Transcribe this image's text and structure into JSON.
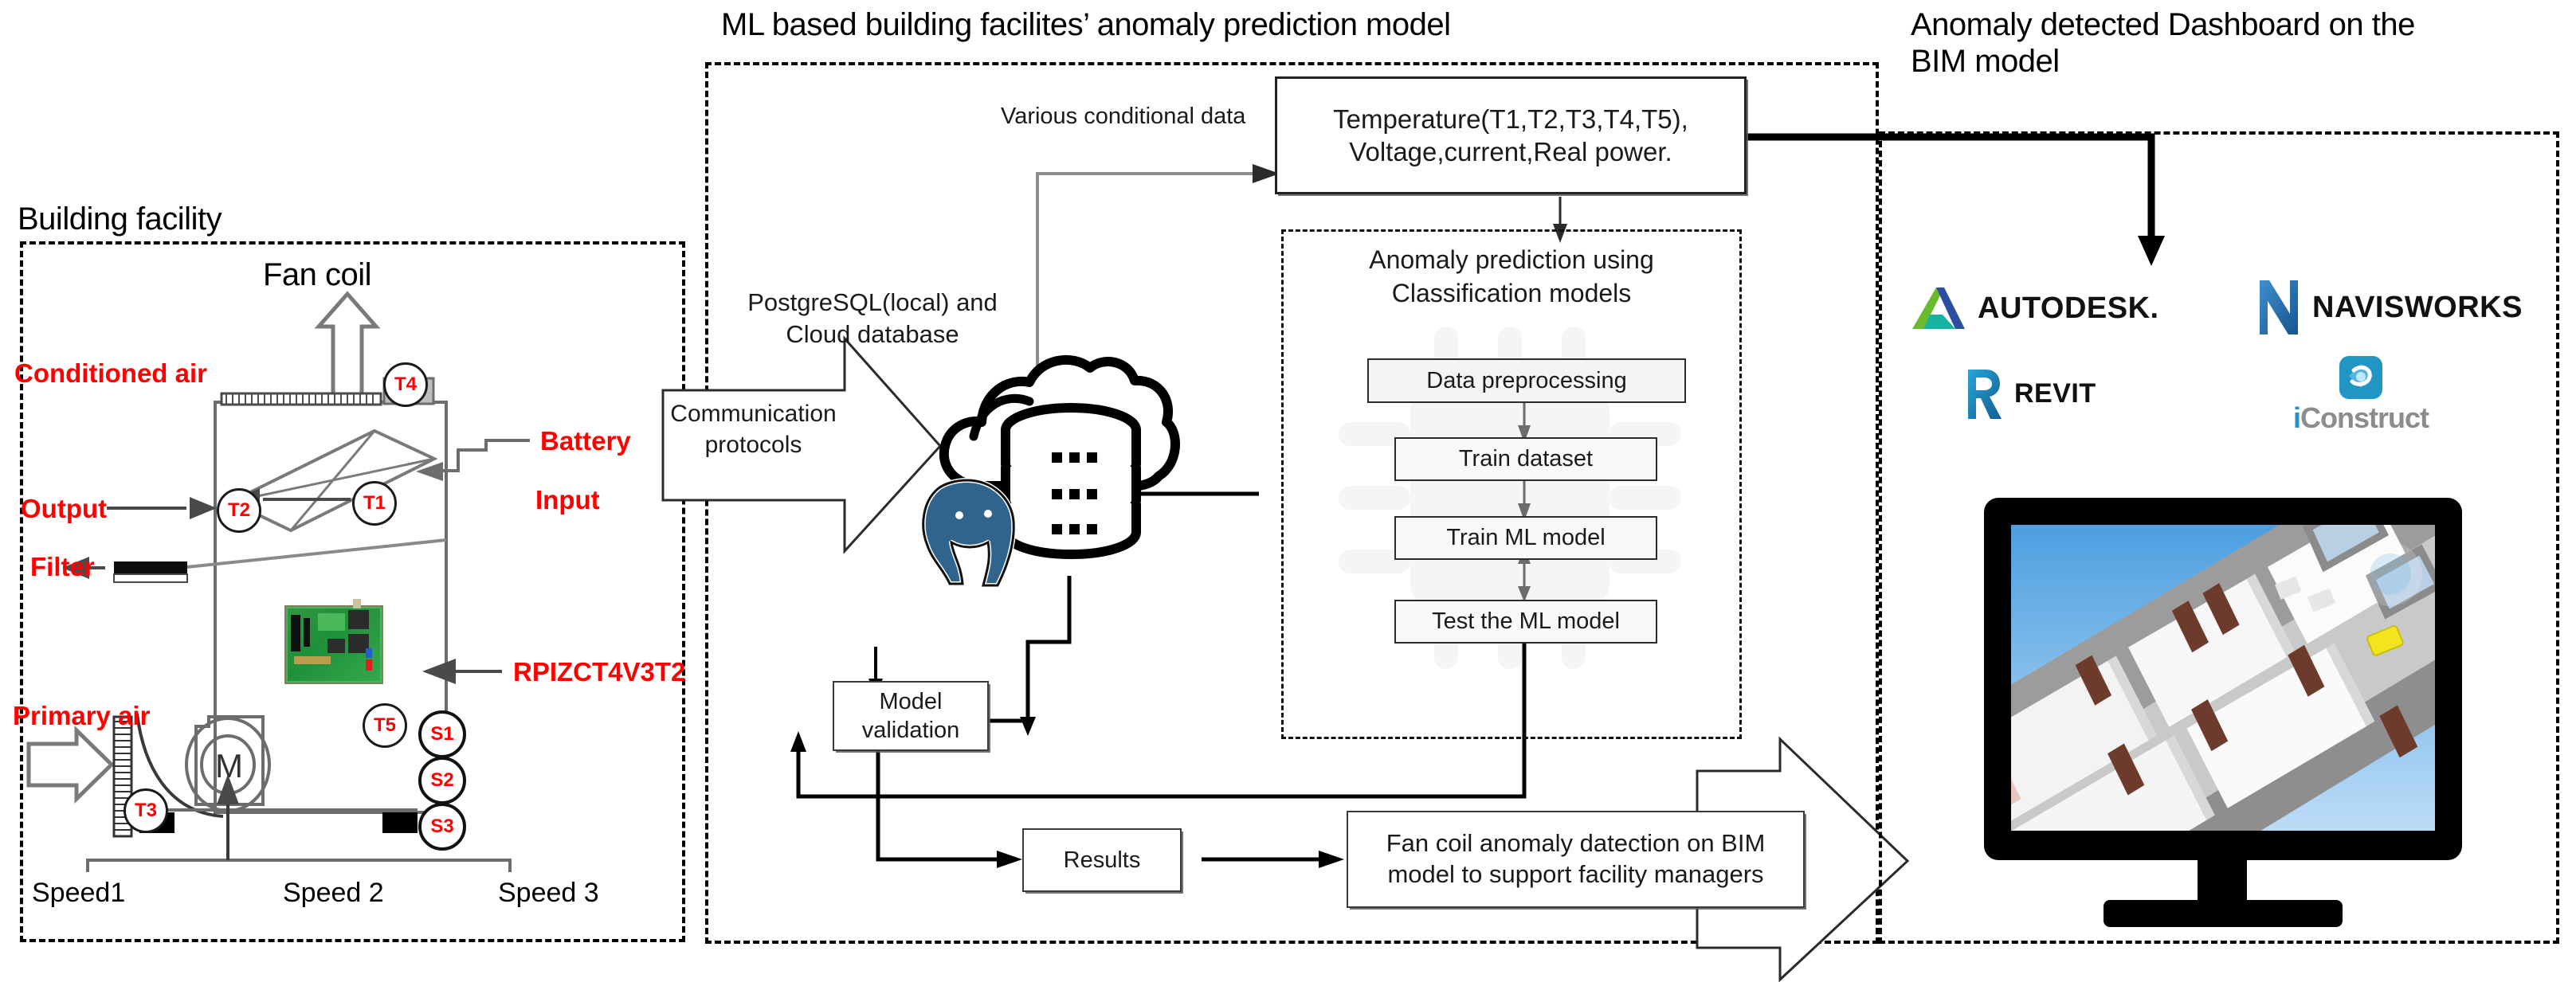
{
  "titles": {
    "ml_section": "ML based building facilites’ anomaly prediction model",
    "bim_section": "Anomaly detected Dashboard on the\nBIM model",
    "building_facility": "Building facility",
    "fan_coil": "Fan coil"
  },
  "building": {
    "labels": {
      "conditioned_air": "Conditioned air",
      "output": "Output",
      "filter": "Filter",
      "primary_air": "Primary air",
      "battery": "Battery",
      "input": "Input",
      "sensor_board": "RPIZCT4V3T2",
      "motor": "M"
    },
    "temperature_sensors": [
      "T4",
      "T2",
      "T1",
      "T5",
      "T3"
    ],
    "speed_sensors": [
      "S1",
      "S2",
      "S3"
    ],
    "speeds": [
      "Speed1",
      "Speed 2",
      "Speed 3"
    ]
  },
  "ml": {
    "communication_protocols": "Communication\nprotocols",
    "database_caption": "PostgreSQL(local) and\nCloud database",
    "various_conditional_data": "Various conditional data",
    "measurements_box": "Temperature(T1,T2,T3,T4,T5),\nVoltage,current,Real power.",
    "anomaly_prediction_title": "Anomaly prediction using\nClassification models",
    "pipeline": [
      "Data preprocessing",
      "Train dataset",
      "Train ML model",
      "Test the ML model"
    ],
    "model_validation": "Model\nvalidation",
    "results": "Results",
    "outcome": "Fan coil anomaly datection on BIM\nmodel to support facility managers"
  },
  "dashboard": {
    "logos": [
      {
        "name": "AUTODESK",
        "mark": "autodesk-mark"
      },
      {
        "name": "NAVISWORKS",
        "mark": "navisworks-mark"
      },
      {
        "name": "REVIT",
        "mark": "revit-mark"
      },
      {
        "name": "iConstruct",
        "mark": "iconstruct-mark"
      }
    ],
    "autodesk_label": "AUTODESK.",
    "navisworks_label": "NAVISWORKS",
    "revit_label": "REVIT",
    "iconstruct_i": "i",
    "iconstruct_rest": "Construct"
  },
  "colors": {
    "red_label": "#ff0000",
    "postgres_blue": "#31648c",
    "autodesk_green": "#6aba2e",
    "autodesk_blue": "#2b4f9e",
    "autodesk_teal": "#16b3a0",
    "navisworks_blue": "#1f6fb5",
    "revit_blue": "#1b84c4",
    "iconstruct_blue": "#2196c4",
    "line": "#1a1a1a",
    "sky": "#8fc4ee"
  }
}
